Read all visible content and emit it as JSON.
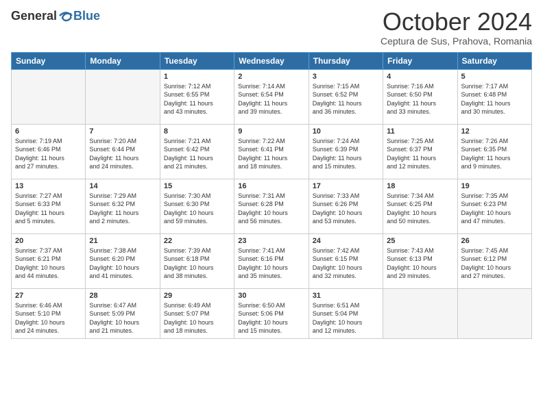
{
  "header": {
    "logo_general": "General",
    "logo_blue": "Blue",
    "month_title": "October 2024",
    "location": "Ceptura de Sus, Prahova, Romania"
  },
  "weekdays": [
    "Sunday",
    "Monday",
    "Tuesday",
    "Wednesday",
    "Thursday",
    "Friday",
    "Saturday"
  ],
  "weeks": [
    [
      {
        "day": "",
        "info": ""
      },
      {
        "day": "",
        "info": ""
      },
      {
        "day": "1",
        "info": "Sunrise: 7:12 AM\nSunset: 6:55 PM\nDaylight: 11 hours\nand 43 minutes."
      },
      {
        "day": "2",
        "info": "Sunrise: 7:14 AM\nSunset: 6:54 PM\nDaylight: 11 hours\nand 39 minutes."
      },
      {
        "day": "3",
        "info": "Sunrise: 7:15 AM\nSunset: 6:52 PM\nDaylight: 11 hours\nand 36 minutes."
      },
      {
        "day": "4",
        "info": "Sunrise: 7:16 AM\nSunset: 6:50 PM\nDaylight: 11 hours\nand 33 minutes."
      },
      {
        "day": "5",
        "info": "Sunrise: 7:17 AM\nSunset: 6:48 PM\nDaylight: 11 hours\nand 30 minutes."
      }
    ],
    [
      {
        "day": "6",
        "info": "Sunrise: 7:19 AM\nSunset: 6:46 PM\nDaylight: 11 hours\nand 27 minutes."
      },
      {
        "day": "7",
        "info": "Sunrise: 7:20 AM\nSunset: 6:44 PM\nDaylight: 11 hours\nand 24 minutes."
      },
      {
        "day": "8",
        "info": "Sunrise: 7:21 AM\nSunset: 6:42 PM\nDaylight: 11 hours\nand 21 minutes."
      },
      {
        "day": "9",
        "info": "Sunrise: 7:22 AM\nSunset: 6:41 PM\nDaylight: 11 hours\nand 18 minutes."
      },
      {
        "day": "10",
        "info": "Sunrise: 7:24 AM\nSunset: 6:39 PM\nDaylight: 11 hours\nand 15 minutes."
      },
      {
        "day": "11",
        "info": "Sunrise: 7:25 AM\nSunset: 6:37 PM\nDaylight: 11 hours\nand 12 minutes."
      },
      {
        "day": "12",
        "info": "Sunrise: 7:26 AM\nSunset: 6:35 PM\nDaylight: 11 hours\nand 9 minutes."
      }
    ],
    [
      {
        "day": "13",
        "info": "Sunrise: 7:27 AM\nSunset: 6:33 PM\nDaylight: 11 hours\nand 5 minutes."
      },
      {
        "day": "14",
        "info": "Sunrise: 7:29 AM\nSunset: 6:32 PM\nDaylight: 11 hours\nand 2 minutes."
      },
      {
        "day": "15",
        "info": "Sunrise: 7:30 AM\nSunset: 6:30 PM\nDaylight: 10 hours\nand 59 minutes."
      },
      {
        "day": "16",
        "info": "Sunrise: 7:31 AM\nSunset: 6:28 PM\nDaylight: 10 hours\nand 56 minutes."
      },
      {
        "day": "17",
        "info": "Sunrise: 7:33 AM\nSunset: 6:26 PM\nDaylight: 10 hours\nand 53 minutes."
      },
      {
        "day": "18",
        "info": "Sunrise: 7:34 AM\nSunset: 6:25 PM\nDaylight: 10 hours\nand 50 minutes."
      },
      {
        "day": "19",
        "info": "Sunrise: 7:35 AM\nSunset: 6:23 PM\nDaylight: 10 hours\nand 47 minutes."
      }
    ],
    [
      {
        "day": "20",
        "info": "Sunrise: 7:37 AM\nSunset: 6:21 PM\nDaylight: 10 hours\nand 44 minutes."
      },
      {
        "day": "21",
        "info": "Sunrise: 7:38 AM\nSunset: 6:20 PM\nDaylight: 10 hours\nand 41 minutes."
      },
      {
        "day": "22",
        "info": "Sunrise: 7:39 AM\nSunset: 6:18 PM\nDaylight: 10 hours\nand 38 minutes."
      },
      {
        "day": "23",
        "info": "Sunrise: 7:41 AM\nSunset: 6:16 PM\nDaylight: 10 hours\nand 35 minutes."
      },
      {
        "day": "24",
        "info": "Sunrise: 7:42 AM\nSunset: 6:15 PM\nDaylight: 10 hours\nand 32 minutes."
      },
      {
        "day": "25",
        "info": "Sunrise: 7:43 AM\nSunset: 6:13 PM\nDaylight: 10 hours\nand 29 minutes."
      },
      {
        "day": "26",
        "info": "Sunrise: 7:45 AM\nSunset: 6:12 PM\nDaylight: 10 hours\nand 27 minutes."
      }
    ],
    [
      {
        "day": "27",
        "info": "Sunrise: 6:46 AM\nSunset: 5:10 PM\nDaylight: 10 hours\nand 24 minutes."
      },
      {
        "day": "28",
        "info": "Sunrise: 6:47 AM\nSunset: 5:09 PM\nDaylight: 10 hours\nand 21 minutes."
      },
      {
        "day": "29",
        "info": "Sunrise: 6:49 AM\nSunset: 5:07 PM\nDaylight: 10 hours\nand 18 minutes."
      },
      {
        "day": "30",
        "info": "Sunrise: 6:50 AM\nSunset: 5:06 PM\nDaylight: 10 hours\nand 15 minutes."
      },
      {
        "day": "31",
        "info": "Sunrise: 6:51 AM\nSunset: 5:04 PM\nDaylight: 10 hours\nand 12 minutes."
      },
      {
        "day": "",
        "info": ""
      },
      {
        "day": "",
        "info": ""
      }
    ]
  ]
}
